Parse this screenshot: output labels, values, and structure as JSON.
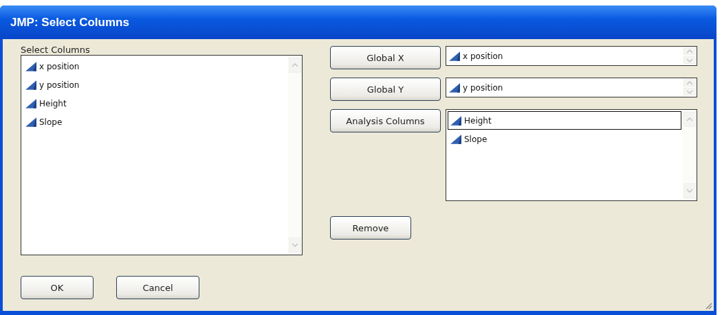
{
  "window": {
    "title": "JMP: Select Columns"
  },
  "select_columns": {
    "label": "Select Columns",
    "items": [
      {
        "name": "x position",
        "selected": false
      },
      {
        "name": "y position",
        "selected": false
      },
      {
        "name": "Height",
        "selected": false
      },
      {
        "name": "Slope",
        "selected": false
      }
    ]
  },
  "roles": [
    {
      "kind": "single",
      "button": "Global X",
      "value": "x position"
    },
    {
      "kind": "single",
      "button": "Global Y",
      "value": "y position"
    },
    {
      "kind": "list",
      "button": "Analysis Columns",
      "items": [
        {
          "name": "Height",
          "selected": true
        },
        {
          "name": "Slope",
          "selected": false
        }
      ]
    }
  ],
  "remove_button": "Remove",
  "buttons": [
    "OK",
    "Cancel"
  ]
}
